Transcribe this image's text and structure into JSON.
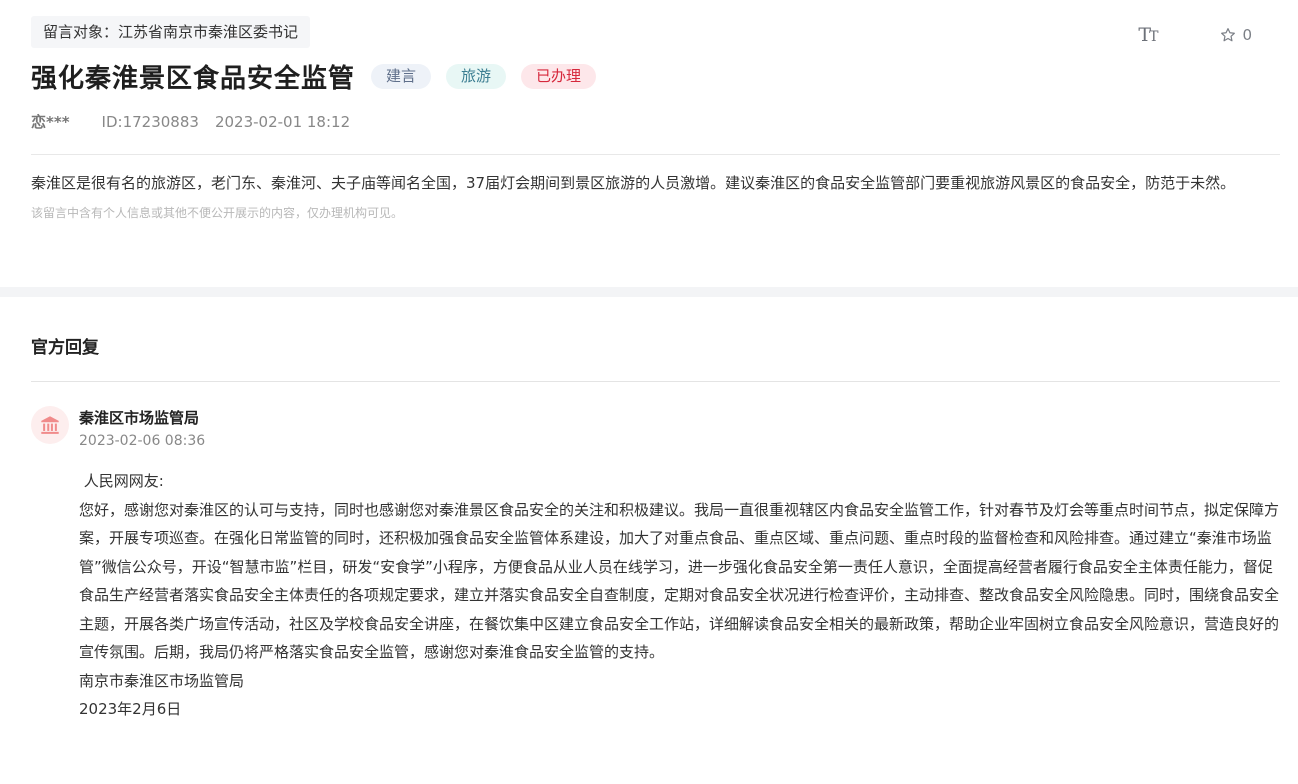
{
  "header": {
    "target_label": "留言对象：江苏省南京市秦淮区委书记",
    "favorite_count": "0",
    "font_icon": "font-size-icon",
    "star_icon": "star-icon"
  },
  "post": {
    "title": "强化秦淮景区食品安全监管",
    "tags": [
      "建言",
      "旅游",
      "已办理"
    ],
    "author": "恋***",
    "id": "ID:17230883",
    "datetime": "2023-02-01 18:12",
    "content": "秦淮区是很有名的旅游区，老门东、秦淮河、夫子庙等闻名全国，37届灯会期间到景区旅游的人员激增。建议秦淮区的食品安全监管部门要重视旅游风景区的食品安全，防范于未然。",
    "privacy_note": "该留言中含有个人信息或其他不便公开展示的内容，仅办理机构可见。"
  },
  "reply": {
    "section_title": "官方回复",
    "org_name": "秦淮区市场监管局",
    "org_time": "2023-02-06 08:36",
    "greeting": " 人民网网友:",
    "body": "您好，感谢您对秦淮区的认可与支持，同时也感谢您对秦淮景区食品安全的关注和积极建议。我局一直很重视辖区内食品安全监管工作，针对春节及灯会等重点时间节点，拟定保障方案，开展专项巡查。在强化日常监管的同时，还积极加强食品安全监管体系建设，加大了对重点食品、重点区域、重点问题、重点时段的监督检查和风险排查。通过建立“秦淮市场监管”微信公众号，开设“智慧市监”栏目，研发“安食学”小程序，方便食品从业人员在线学习，进一步强化食品安全第一责任人意识，全面提高经营者履行食品安全主体责任能力，督促食品生产经营者落实食品安全主体责任的各项规定要求，建立并落实食品安全自查制度，定期对食品安全状况进行检查评价，主动排查、整改食品安全风险隐患。同时，围绕食品安全主题，开展各类广场宣传活动，社区及学校食品安全讲座，在餐饮集中区建立食品安全工作站，详细解读食品安全相关的最新政策，帮助企业牢固树立食品安全风险意识，营造良好的宣传氛围。后期，我局仍将严格落实食品安全监管，感谢您对秦淮食品安全监管的支持。",
    "signature": "南京市秦淮区市场监管局",
    "sign_date": "2023年2月6日"
  },
  "colors": {
    "tag_red": "#d6283c",
    "accent_avatar": "#f08b8b"
  }
}
